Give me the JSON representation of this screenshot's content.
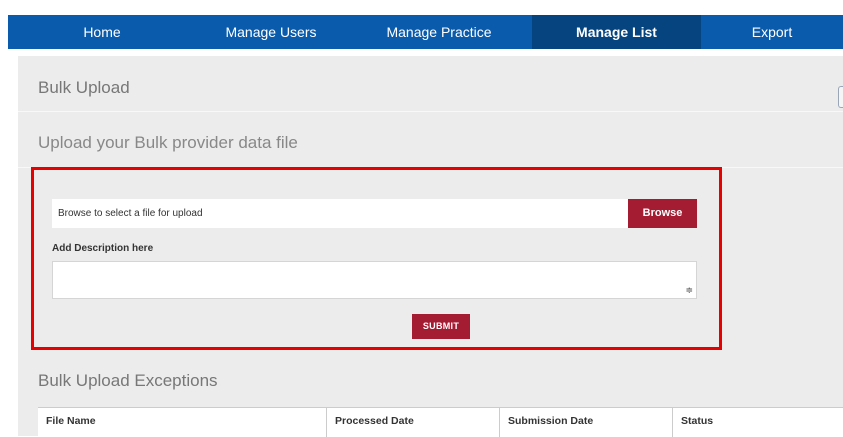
{
  "nav": {
    "items": [
      {
        "label": "Home",
        "active": false
      },
      {
        "label": "Manage Users",
        "active": false
      },
      {
        "label": "Manage Practice",
        "active": false
      },
      {
        "label": "Manage List",
        "active": true
      },
      {
        "label": "Export",
        "active": false
      }
    ]
  },
  "page": {
    "title": "Bulk Upload",
    "subtitle": "Upload your Bulk provider data file"
  },
  "upload": {
    "file_placeholder": "Browse to select a file for upload",
    "browse_label": "Browse",
    "description_label": "Add Description here",
    "description_value": "",
    "submit_label": "SUBMIT"
  },
  "exceptions": {
    "title": "Bulk Upload Exceptions",
    "columns": [
      "File Name",
      "Processed Date",
      "Submission Date",
      "Status"
    ]
  },
  "colors": {
    "nav": "#0a5bab",
    "nav_active": "#06447f",
    "button": "#a31c32",
    "highlight": "#e60000"
  }
}
